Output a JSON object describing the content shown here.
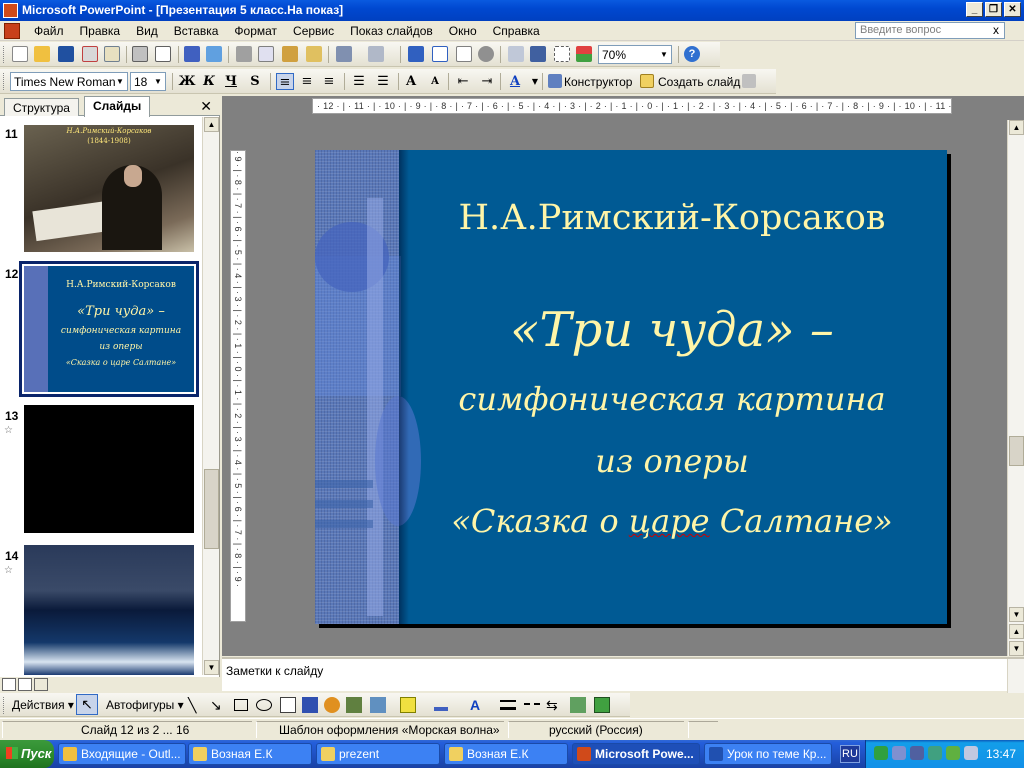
{
  "window": {
    "title": "Microsoft PowerPoint - [Презентация 5 класс.На показ]",
    "buttons": [
      "_",
      "❐",
      "✕"
    ]
  },
  "menu": {
    "items": [
      {
        "label": "Файл"
      },
      {
        "label": "Правка"
      },
      {
        "label": "Вид"
      },
      {
        "label": "Вставка"
      },
      {
        "label": "Формат"
      },
      {
        "label": "Сервис"
      },
      {
        "label": "Показ слайдов"
      },
      {
        "label": "Окно"
      },
      {
        "label": "Справка"
      }
    ],
    "help_placeholder": "Введите вопрос",
    "close": "x"
  },
  "toolbar_standard": {
    "zoom": "70%",
    "help": "?"
  },
  "toolbar_format": {
    "font": "Times New Roman",
    "size": "18",
    "bold": "Ж",
    "italic": "К",
    "underline": "Ч",
    "shadow": "S",
    "font_color": "A",
    "design_label": "Конструктор",
    "new_slide_label": "Создать слайд"
  },
  "left_pane": {
    "tabs": [
      "Структура",
      "Слайды"
    ],
    "close": "✕",
    "thumbnails": [
      {
        "number": "11",
        "title": "Н.А.Римский-Корсаков",
        "subtitle": "(1844-1908)"
      },
      {
        "number": "12",
        "lines": [
          "Н.А.Римский-Корсаков",
          "«Три чуда» –",
          "симфоническая картина",
          "из оперы",
          "«Сказка о царе Салтане»"
        ]
      },
      {
        "number": "13",
        "star": "☆"
      },
      {
        "number": "14",
        "star": "☆"
      }
    ]
  },
  "rulers": {
    "horizontal": "· 12 · | · 11 · | · 10 · | · 9 · | · 8 · | · 7 · | · 6 · | · 5 · | · 4 · | · 3 · | · 2 · | · 1 · | · 0 · | · 1 · | · 2 · | · 3 · | · 4 · | · 5 · | · 6 · | · 7 · | · 8 · | · 9 · | · 10 · | · 11 · | · 12 ·",
    "vertical": "· 9 · | · 8 · | · 7 · | · 6 · | · 5 · | · 4 · | · 3 · | · 2 · | · 1 · | · 0 · | · 1 · | · 2 · | · 3 · | · 4 · | · 5 · | · 6 · | · 7 · | · 8 · | · 9 ·"
  },
  "slide": {
    "title": "Н.А.Римский-Корсаков",
    "big": "«Три чуда» –",
    "line1": "симфоническая картина",
    "line2": "из оперы",
    "line3_prefix": "«Сказка о ",
    "line3_misspelled": "царе",
    "line3_suffix": " Салтане»",
    "colors": {
      "background": "#005a94",
      "text": "#fff5a8"
    }
  },
  "notes": {
    "placeholder": "Заметки к слайду"
  },
  "drawing_toolbar": {
    "actions_label": "Действия",
    "autoshapes_label": "Автофигуры"
  },
  "status": {
    "slide": "Слайд 12 из 2 ... 16",
    "template": "Шаблон оформления «Морская волна»",
    "language": "русский (Россия)"
  },
  "taskbar": {
    "start": "Пуск",
    "tasks": [
      {
        "label": "Входящие - Outl..."
      },
      {
        "label": "Возная Е.К"
      },
      {
        "label": "prezent"
      },
      {
        "label": "Возная Е.К"
      },
      {
        "label": "Microsoft Powe..."
      },
      {
        "label": "Урок по теме Кр..."
      }
    ],
    "lang": "RU",
    "clock": "13:47"
  }
}
